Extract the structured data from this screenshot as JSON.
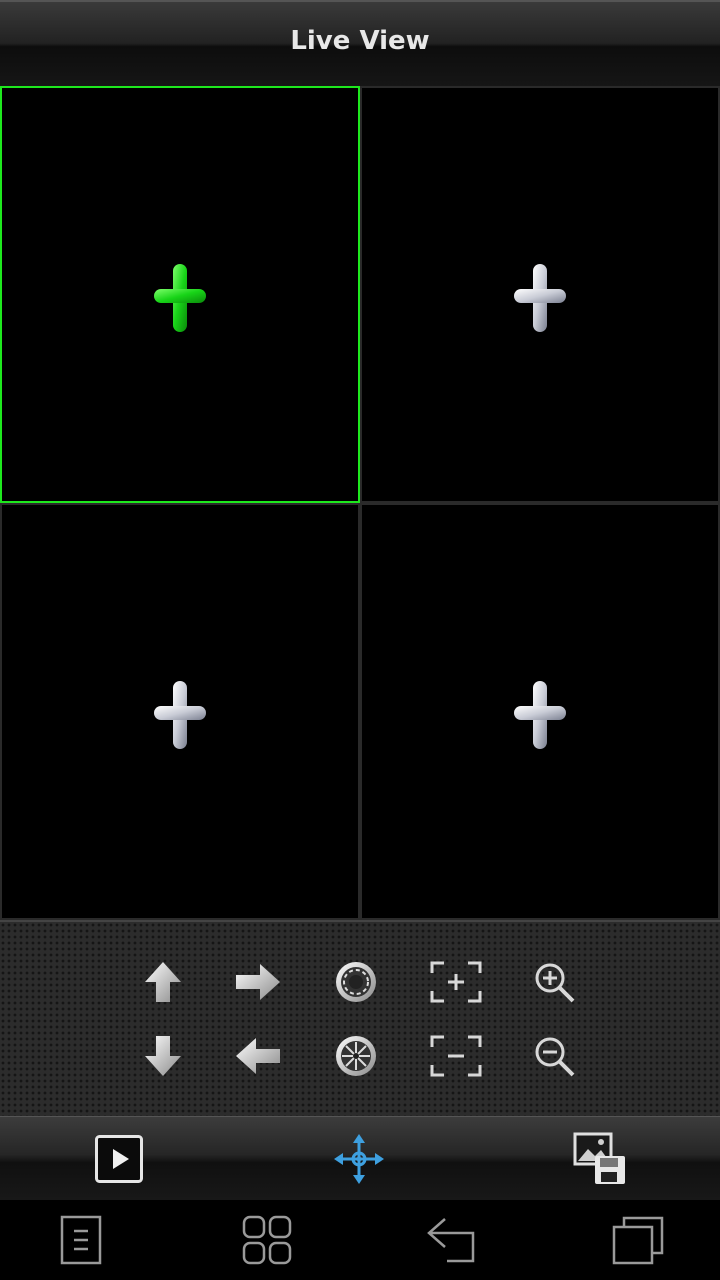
{
  "titlebar": {
    "title": "Live View"
  },
  "grid": {
    "panes": [
      {
        "label": "channel-1",
        "selected": true
      },
      {
        "label": "channel-2",
        "selected": false
      },
      {
        "label": "channel-3",
        "selected": false
      },
      {
        "label": "channel-4",
        "selected": false
      }
    ],
    "icon": "plus-icon",
    "selected_color": "#1ee81e"
  },
  "ptz": {
    "controls": [
      "tilt-up-icon",
      "pan-right-icon",
      "iris-open-icon",
      "focus-near-icon",
      "zoom-in-icon",
      "tilt-down-icon",
      "pan-left-icon",
      "iris-close-icon",
      "focus-far-icon",
      "zoom-out-icon"
    ]
  },
  "toolbar": {
    "items": [
      "play-icon",
      "ptz-move-icon",
      "snapshot-save-icon"
    ],
    "accent": "#3ea0e0"
  },
  "navbar": {
    "items": [
      "menu-icon",
      "multi-window-icon",
      "back-icon",
      "recent-apps-icon"
    ]
  }
}
